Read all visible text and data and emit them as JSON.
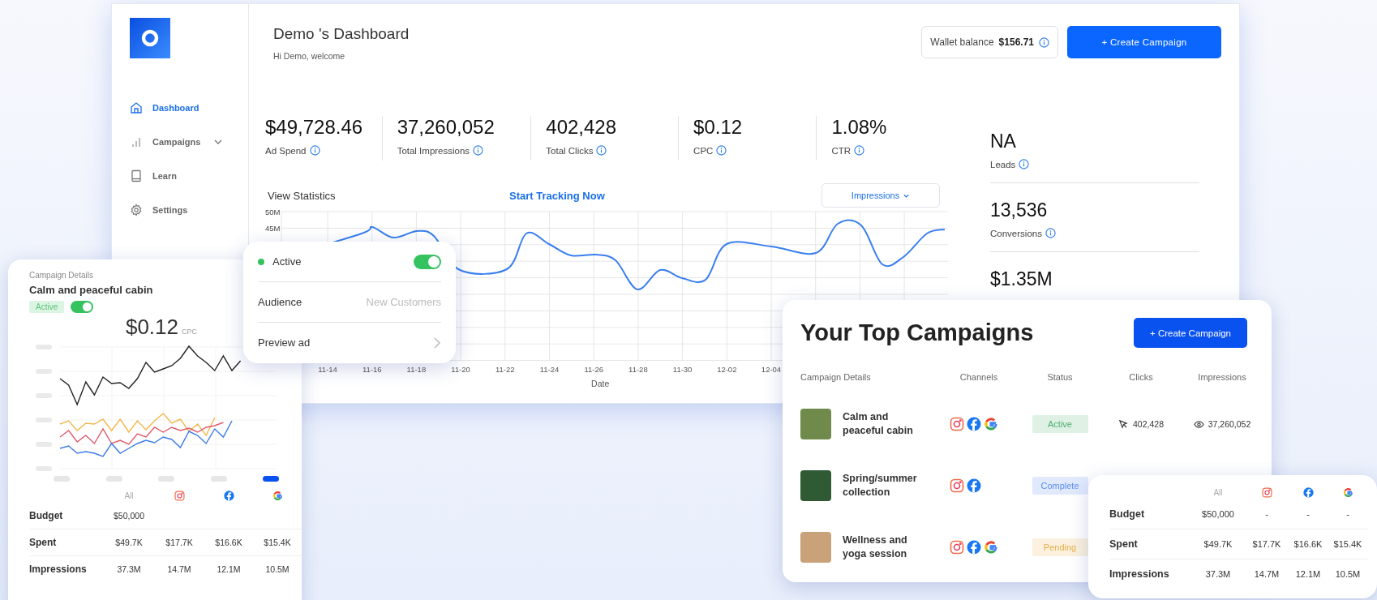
{
  "sidebar": {
    "items": [
      {
        "label": "Dashboard",
        "kind": "link",
        "selected": true
      },
      {
        "label": "Campaigns",
        "kind": "group",
        "selected": false
      },
      {
        "label": "Learn",
        "kind": "link",
        "selected": false
      },
      {
        "label": "Settings",
        "kind": "link",
        "selected": false
      }
    ]
  },
  "header": {
    "title": "Demo 's Dashboard",
    "subtitle": "Hi Demo, welcome",
    "wallet_label": "Wallet balance",
    "wallet_amount": "$156.71",
    "create_button": "+ Create Campaign"
  },
  "stats": [
    {
      "value": "$49,728.46",
      "label": "Ad Spend"
    },
    {
      "value": "37,260,052",
      "label": "Total Impressions"
    },
    {
      "value": "402,428",
      "label": "Total Clicks"
    },
    {
      "value": "$0.12",
      "label": "CPC"
    },
    {
      "value": "1.08%",
      "label": "CTR"
    }
  ],
  "side_stats": [
    {
      "value": "NA",
      "label": "Leads"
    },
    {
      "value": "13,536",
      "label": "Conversions"
    },
    {
      "value": "$1.35M"
    }
  ],
  "statistics": {
    "title": "View Statistics",
    "link": "Start Tracking Now",
    "metric": "Impressions",
    "y_ticks": [
      "50M",
      "45M"
    ],
    "x_labels": [
      "11-14",
      "11-16",
      "11-18",
      "11-20",
      "11-22",
      "11-24",
      "11-26",
      "11-28",
      "11-30",
      "12-02",
      "12-04"
    ],
    "xlabel": "Date"
  },
  "campaign_card": {
    "caption": "Campaign Details",
    "name": "Calm and peaceful cabin",
    "status": "Active",
    "on": true,
    "value": "$0.12",
    "unit": "CPC",
    "range_pills": [
      {
        "selected": false
      },
      {
        "selected": false
      },
      {
        "selected": false
      },
      {
        "selected": false
      },
      {
        "selected": true
      }
    ],
    "columns": [
      {
        "kind": "text",
        "label": "All"
      },
      {
        "kind": "instagram"
      },
      {
        "kind": "facebook"
      },
      {
        "kind": "google"
      }
    ],
    "rows": [
      {
        "label": "Budget",
        "cells": [
          "$50,000"
        ]
      },
      {
        "label": "Spent",
        "cells": [
          "$49.7K",
          "$17.7K",
          "$16.6K",
          "$15.4K"
        ]
      },
      {
        "label": "Impressions",
        "cells": [
          "37.3M",
          "14.7M",
          "12.1M",
          "10.5M"
        ]
      }
    ]
  },
  "status_popup": {
    "rows": [
      {
        "kind": "toggle",
        "label": "Active",
        "on": true
      },
      {
        "kind": "value",
        "label": "Audience",
        "value": "New Customers"
      },
      {
        "kind": "link",
        "label": "Preview ad"
      }
    ]
  },
  "top_campaigns": {
    "title": "Your Top Campaigns",
    "button": "+ Create Campaign",
    "columns": [
      "Campaign Details",
      "Channels",
      "Status",
      "Clicks",
      "Impressions"
    ],
    "rows": [
      {
        "name": "Calm and peaceful cabin",
        "channels": [
          {
            "kind": "instagram"
          },
          {
            "kind": "facebook"
          },
          {
            "kind": "google"
          }
        ],
        "status": "Active",
        "color": "#4caf6e",
        "clicks": "402,428",
        "impressions": "37,260,052"
      },
      {
        "name": "Spring/summer collection",
        "channels": [
          {
            "kind": "instagram"
          },
          {
            "kind": "facebook"
          }
        ],
        "status": "Complete",
        "color": "#5b8def"
      },
      {
        "name": "Wellness and yoga session",
        "channels": [
          {
            "kind": "instagram"
          },
          {
            "kind": "facebook"
          },
          {
            "kind": "google"
          }
        ],
        "status": "Pending",
        "color": "#e8b04a"
      }
    ]
  },
  "budget_card": {
    "columns": [
      {
        "kind": "text",
        "label": "All"
      },
      {
        "kind": "instagram"
      },
      {
        "kind": "facebook"
      },
      {
        "kind": "google"
      }
    ],
    "rows": [
      {
        "label": "Budget",
        "cells": [
          "$50,000",
          "-",
          "-",
          "-"
        ]
      },
      {
        "label": "Spent",
        "cells": [
          "$49.7K",
          "$17.7K",
          "$16.6K",
          "$15.4K"
        ]
      },
      {
        "label": "Impressions",
        "cells": [
          "37.3M",
          "14.7M",
          "12.1M",
          "10.5M"
        ]
      }
    ]
  }
}
